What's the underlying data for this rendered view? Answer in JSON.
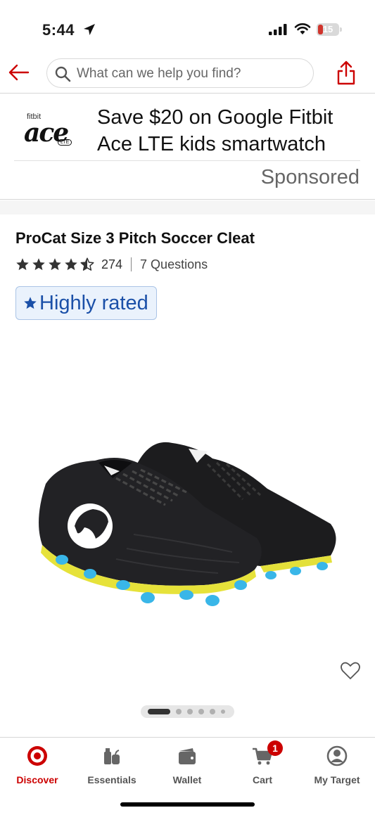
{
  "status_bar": {
    "time": "5:44",
    "battery": "15"
  },
  "search": {
    "placeholder": "What can we help you find?"
  },
  "ad": {
    "brand": "fitbit",
    "logo_word": "ace",
    "logo_badge": "LTE",
    "title": "Save $20 on Google Fitbit Ace LTE kids smartwatch",
    "sponsored_label": "Sponsored"
  },
  "product": {
    "title": "ProCat Size 3 Pitch Soccer Cleat",
    "rating": 4.5,
    "rating_count": "274",
    "questions": "7 Questions",
    "badge": "Highly rated"
  },
  "gallery": {
    "current": 1,
    "total": 6
  },
  "tabs": [
    {
      "label": "Discover",
      "icon": "target-logo-icon",
      "active": true
    },
    {
      "label": "Essentials",
      "icon": "essentials-icon",
      "active": false
    },
    {
      "label": "Wallet",
      "icon": "wallet-icon",
      "active": false
    },
    {
      "label": "Cart",
      "icon": "cart-icon",
      "active": false,
      "badge": "1"
    },
    {
      "label": "My Target",
      "icon": "account-icon",
      "active": false
    }
  ],
  "colors": {
    "brand_red": "#cc0000",
    "badge_blue": "#1b50a8",
    "badge_bg": "#eaf2fc"
  }
}
